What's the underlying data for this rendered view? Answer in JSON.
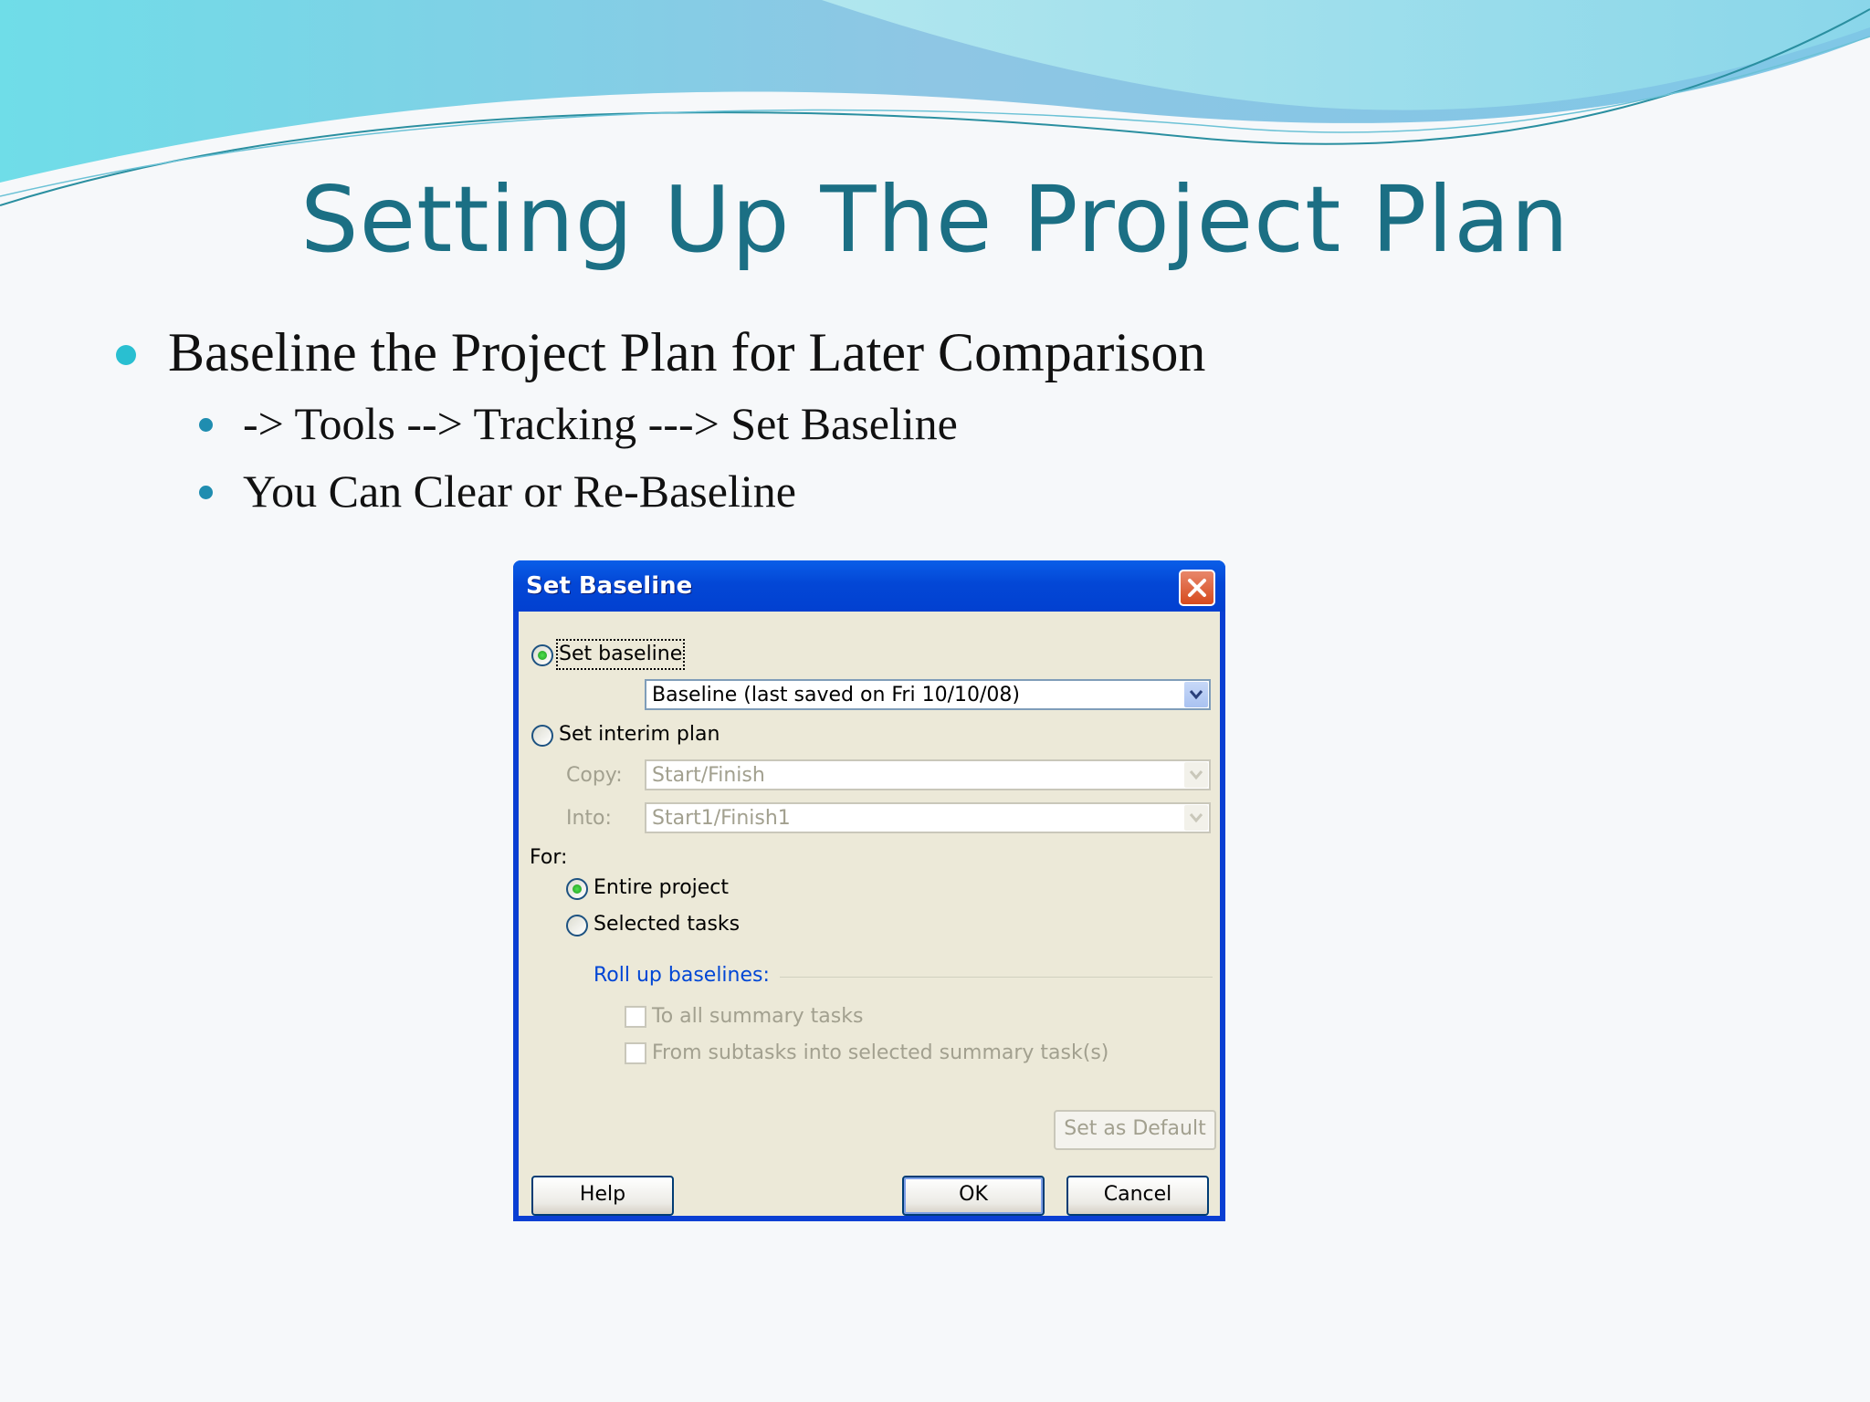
{
  "slide": {
    "title": "Setting Up The Project Plan",
    "bullets": [
      "Baseline the Project Plan for Later Comparison",
      "-> Tools --> Tracking ---> Set Baseline",
      "You Can Clear or Re-Baseline"
    ]
  },
  "dialog": {
    "title": "Set Baseline",
    "set_baseline_label": "Set baseline",
    "baseline_value": "Baseline (last saved on Fri 10/10/08)",
    "set_interim_label": "Set interim plan",
    "copy_label": "Copy:",
    "copy_value": "Start/Finish",
    "into_label": "Into:",
    "into_value": "Start1/Finish1",
    "for_label": "For:",
    "entire_project_label": "Entire project",
    "selected_tasks_label": "Selected tasks",
    "roll_up_label": "Roll up baselines:",
    "to_all_summary_label": "To all summary tasks",
    "from_subtasks_label": "From subtasks into selected summary task(s)",
    "set_default_label": "Set as Default",
    "help_label": "Help",
    "ok_label": "OK",
    "cancel_label": "Cancel",
    "selected_mode": "Set baseline",
    "selected_scope": "Entire project"
  },
  "colors": {
    "title": "#1b6f84",
    "titlebar": "#0347d6",
    "dialog_bg": "#ece9d8",
    "group_label": "#0046d5",
    "disabled_text": "#a2a08f"
  },
  "icons": {
    "close": "close-icon",
    "dropdown": "chevron-down-icon"
  }
}
